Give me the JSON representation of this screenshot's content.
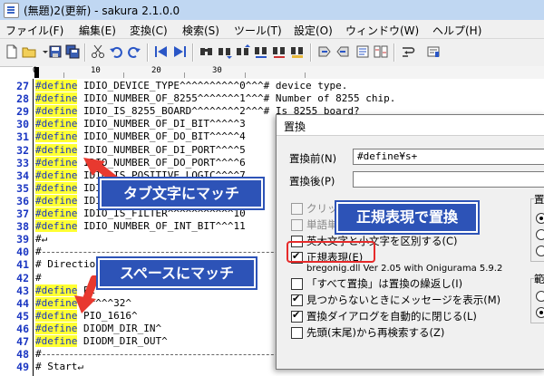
{
  "window": {
    "title": "(無題)2(更新) - sakura 2.1.0.0"
  },
  "menu": [
    "ファイル(F)",
    "編集(E)",
    "変換(C)",
    "検索(S)",
    "ツール(T)",
    "設定(O)",
    "ウィンドウ(W)",
    "ヘルプ(H)"
  ],
  "ruler": {
    "marks": [
      "0",
      "10",
      "20",
      "30"
    ]
  },
  "editor": {
    "lines": [
      {
        "no": "27",
        "kw": "#define",
        "rest": " IDIO_DEVICE_TYPE^^^^^^^^^^0^^^# device type."
      },
      {
        "no": "28",
        "kw": "#define",
        "rest": " IDIO_NUMBER_OF_8255^^^^^^^1^^^# Number of 8255 chip."
      },
      {
        "no": "29",
        "kw": "#define",
        "rest": " IDIO_IS_8255_BOARD^^^^^^^^2^^^# Is 8255 board?"
      },
      {
        "no": "30",
        "kw": "#define",
        "rest": " IDIO_NUMBER_OF_DI_BIT^^^^^3"
      },
      {
        "no": "31",
        "kw": "#define",
        "rest": " IDIO_NUMBER_OF_DO_BIT^^^^^4"
      },
      {
        "no": "32",
        "kw": "#define",
        "rest": " IDIO_NUMBER_OF_DI_PORT^^^^5"
      },
      {
        "no": "33",
        "kw": "#define",
        "rest": " IDIO_NUMBER_OF_DO_PORT^^^^6"
      },
      {
        "no": "34",
        "kw": "#define",
        "rest": " IDIO_IS_POSITIVE_LOGIC^^^^7"
      },
      {
        "no": "35",
        "kw": "#define",
        "rest": " IDI^^^^^^^^^^^^^^^^^^^^^^8"
      },
      {
        "no": "36",
        "kw": "#define",
        "rest": " IDI^^^^^^^^^^^^^^^^^^^^^^9"
      },
      {
        "no": "37",
        "kw": "#define",
        "rest": " IDIO_IS_FILTER^^^^^^^^^^^10"
      },
      {
        "no": "38",
        "kw": "#define",
        "rest": " IDIO_NUMBER_OF_INT_BIT^^^11"
      },
      {
        "no": "39",
        "kw": "",
        "rest": "#↵"
      },
      {
        "no": "40",
        "kw": "",
        "rest": "#"
      },
      {
        "no": "41",
        "kw": "",
        "rest": "# Direction"
      },
      {
        "no": "42",
        "kw": "",
        "rest": "#"
      },
      {
        "no": "43",
        "kw": "#define",
        "rest": " PI"
      },
      {
        "no": "44",
        "kw": "#define",
        "rest": " P^^^^32^"
      },
      {
        "no": "45",
        "kw": "#define",
        "rest": " PIO_1616^"
      },
      {
        "no": "46",
        "kw": "#define",
        "rest": " DIODM_DIR_IN^"
      },
      {
        "no": "47",
        "kw": "#define",
        "rest": " DIODM_DIR_OUT^"
      },
      {
        "no": "48",
        "kw": "",
        "rest": "#"
      },
      {
        "no": "49",
        "kw": "",
        "rest": "# Start↵"
      }
    ]
  },
  "dialog": {
    "title": "置換",
    "find_label": "置換前(N)",
    "find_value": "#define¥s+",
    "replace_label": "置換後(P)",
    "replace_value": "",
    "options": [
      {
        "label": "クリッ",
        "checked": false,
        "disabled": true
      },
      {
        "label": "単語単",
        "checked": false,
        "disabled": true
      },
      {
        "label": "英大文字と小文字を区別する(C)",
        "checked": false,
        "disabled": false
      },
      {
        "label": "正規表現(E)",
        "checked": true,
        "disabled": false
      },
      {
        "label": "「すべて置換」は置換の繰返し(I)",
        "checked": false,
        "disabled": false
      },
      {
        "label": "見つからないときにメッセージを表示(M)",
        "checked": true,
        "disabled": false
      },
      {
        "label": "置換ダイアログを自動的に閉じる(L)",
        "checked": true,
        "disabled": false
      },
      {
        "label": "先頭(末尾)から再検索する(Z)",
        "checked": false,
        "disabled": false
      }
    ],
    "regex_lib": "bregonig.dll Ver 2.05 with Onigurama 5.9.2",
    "side_label_1": "置",
    "side_label_2": "範"
  },
  "callouts": {
    "tab": "タブ文字にマッチ",
    "space": "スペースにマッチ",
    "regex": "正規表現で置換"
  },
  "colors": {
    "keyword_bg": "#ffff33",
    "line_number": "#1a36c2",
    "callout_bg": "#2d53b7",
    "highlight_border": "#e62a2a"
  }
}
